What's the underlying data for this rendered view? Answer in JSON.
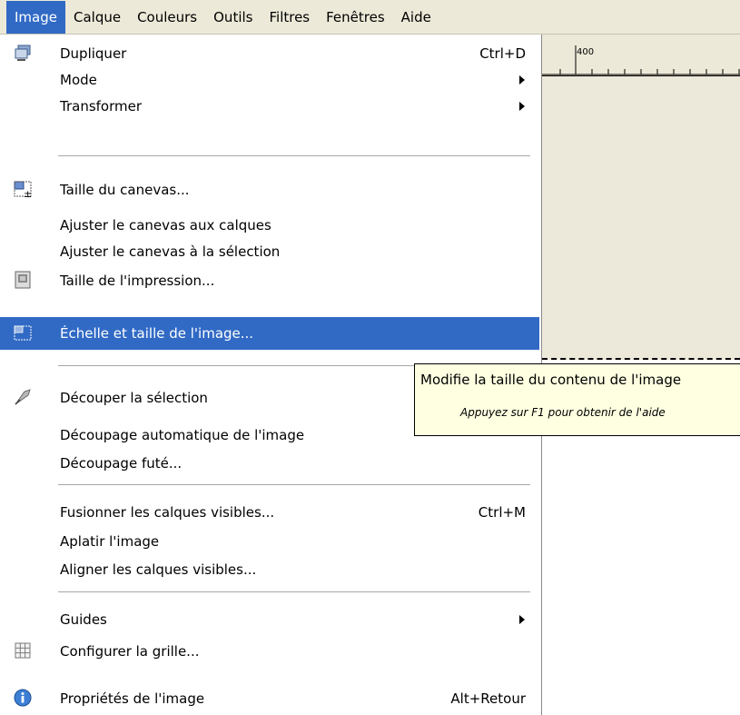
{
  "menubar": {
    "items": [
      {
        "name": "image",
        "label": "Image",
        "open": true
      },
      {
        "name": "calque",
        "label": "Calque"
      },
      {
        "name": "couleurs",
        "label": "Couleurs"
      },
      {
        "name": "outils",
        "label": "Outils"
      },
      {
        "name": "filtres",
        "label": "Filtres"
      },
      {
        "name": "fenetres",
        "label": "Fenêtres"
      },
      {
        "name": "aide",
        "label": "Aide"
      }
    ]
  },
  "ruler": {
    "label": "400"
  },
  "image_menu": {
    "items": [
      {
        "label": "Dupliquer",
        "shortcut": "Ctrl+D",
        "icon": "duplicate-icon"
      },
      {
        "label": "Mode",
        "submenu": true
      },
      {
        "label": "Transformer",
        "submenu": true
      },
      {
        "label": "Taille du canevas...",
        "icon": "canvas-size-icon"
      },
      {
        "label": "Ajuster le canevas aux calques"
      },
      {
        "label": "Ajuster le canevas à la sélection"
      },
      {
        "label": "Taille de l'impression...",
        "icon": "print-size-icon"
      },
      {
        "label": "Échelle et taille de l'image...",
        "icon": "scale-image-icon",
        "highlighted": true
      },
      {
        "label": "Découper la sélection",
        "icon": "crop-icon"
      },
      {
        "label": "Découpage automatique de l'image"
      },
      {
        "label": "Découpage futé..."
      },
      {
        "label": "Fusionner les calques visibles...",
        "shortcut": "Ctrl+M"
      },
      {
        "label": "Aplatir l'image"
      },
      {
        "label": "Aligner les calques visibles..."
      },
      {
        "label": "Guides",
        "submenu": true
      },
      {
        "label": "Configurer la grille...",
        "icon": "grid-icon"
      },
      {
        "label": "Propriétés de l'image",
        "shortcut": "Alt+Retour",
        "icon": "info-icon"
      }
    ]
  },
  "tooltip": {
    "main": "Modifie la taille du contenu de l'image",
    "hint": "Appuyez sur F1 pour obtenir de l'aide"
  },
  "colors": {
    "highlight": "#316ac5",
    "menubar_bg": "#ece9d8",
    "tooltip_bg": "#ffffe1"
  }
}
